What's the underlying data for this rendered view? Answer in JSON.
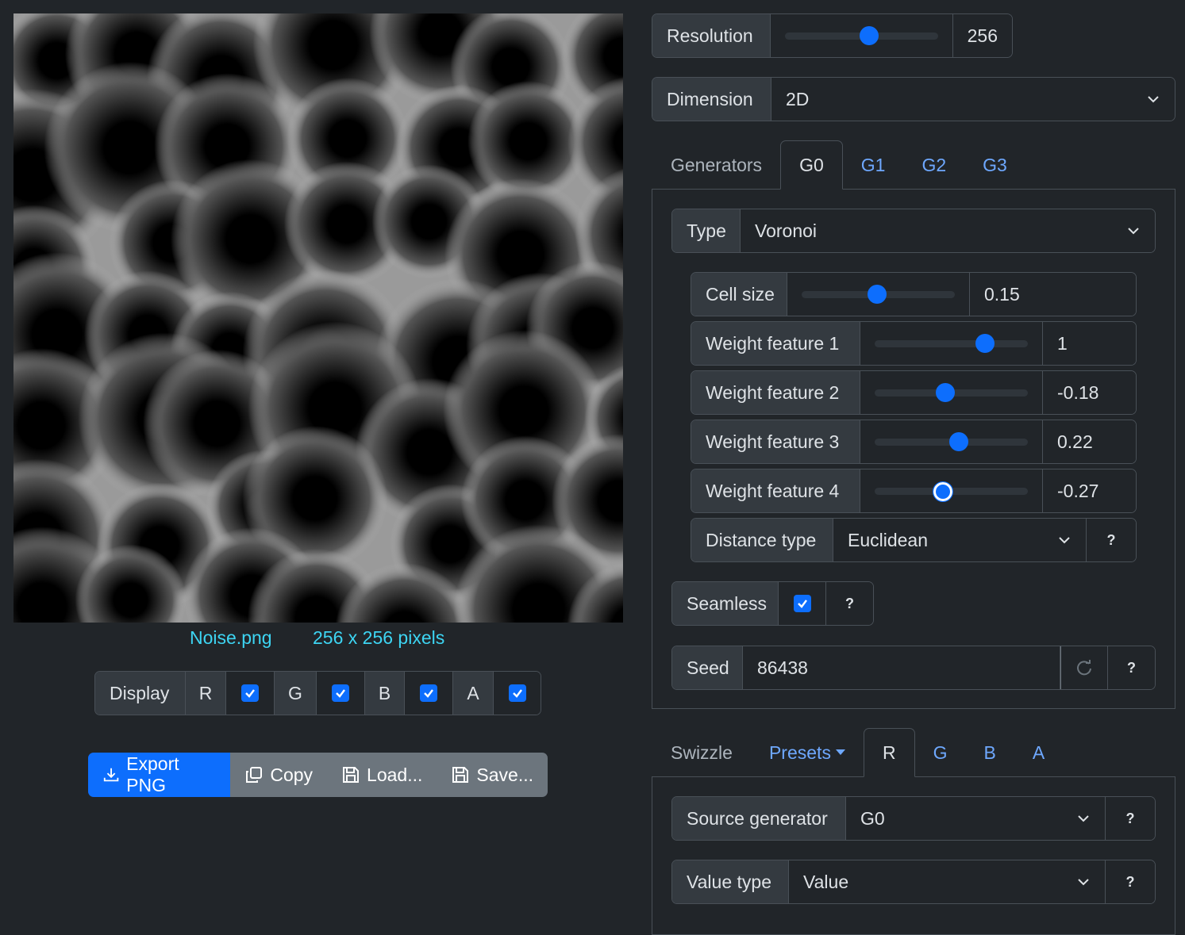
{
  "preview": {
    "filename": "Noise.png",
    "size_text": "256 x 256 pixels"
  },
  "display": {
    "label": "Display",
    "channels": [
      {
        "label": "R",
        "checked": true
      },
      {
        "label": "G",
        "checked": true
      },
      {
        "label": "B",
        "checked": true
      },
      {
        "label": "A",
        "checked": true
      }
    ]
  },
  "actions": {
    "export": "Export PNG",
    "copy": "Copy",
    "load": "Load...",
    "save": "Save..."
  },
  "resolution": {
    "label": "Resolution",
    "value": "256",
    "fraction": 0.55
  },
  "dimension": {
    "label": "Dimension",
    "value": "2D"
  },
  "generator_tabs": {
    "title": "Generators",
    "items": [
      "G0",
      "G1",
      "G2",
      "G3"
    ],
    "active": "G0"
  },
  "generator": {
    "type_label": "Type",
    "type_value": "Voronoi",
    "sliders": [
      {
        "label": "Cell size",
        "value": "0.15",
        "fraction": 0.49
      },
      {
        "label": "Weight feature 1",
        "value": "1",
        "fraction": 0.72
      },
      {
        "label": "Weight feature 2",
        "value": "-0.18",
        "fraction": 0.46
      },
      {
        "label": "Weight feature 3",
        "value": "0.22",
        "fraction": 0.55
      },
      {
        "label": "Weight feature 4",
        "value": "-0.27",
        "fraction": 0.44
      }
    ],
    "distance_label": "Distance type",
    "distance_value": "Euclidean",
    "seamless_label": "Seamless",
    "seamless_checked": true,
    "seed_label": "Seed",
    "seed_value": "86438",
    "help": "?"
  },
  "swizzle": {
    "title": "Swizzle",
    "presets": "Presets",
    "tabs": [
      "R",
      "G",
      "B",
      "A"
    ],
    "active": "R",
    "source_label": "Source generator",
    "source_value": "G0",
    "value_type_label": "Value type",
    "value_type_value": "Value"
  },
  "colors": {
    "accent": "#0d6efd",
    "link": "#6ea8fe",
    "caption": "#3dd5f3",
    "bg": "#212529",
    "label_bg": "#343a40",
    "border": "#495057"
  }
}
